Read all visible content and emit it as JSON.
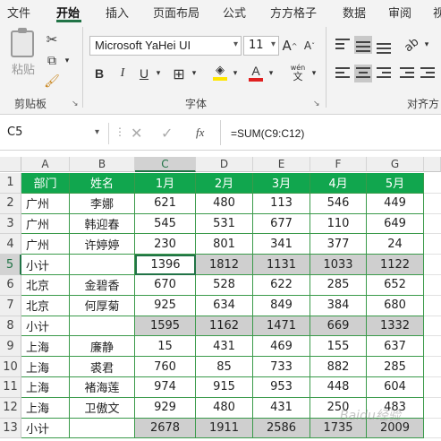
{
  "ribbon": {
    "tabs": [
      "文件",
      "开始",
      "插入",
      "页面布局",
      "公式",
      "方方格子",
      "数据",
      "审阅",
      "视"
    ],
    "active_tab": "开始",
    "clipboard": {
      "paste_label": "粘贴",
      "group_label": "剪贴板"
    },
    "font": {
      "name": "Microsoft YaHei UI",
      "size": "11",
      "grow": "A",
      "shrink": "A",
      "bold": "B",
      "italic": "I",
      "underline": "U",
      "wen_top": "wén",
      "wen_bottom": "文",
      "group_label": "字体"
    },
    "alignment": {
      "group_label": "对齐方"
    },
    "colors": {
      "accent": "#217346",
      "highlight": "#ffe600",
      "font_color": "#e02020"
    }
  },
  "formula_bar": {
    "name_box": "C5",
    "fx": "fx",
    "formula": "=SUM(C9:C12)"
  },
  "sheet": {
    "columns": [
      "A",
      "B",
      "C",
      "D",
      "E",
      "F",
      "G"
    ],
    "rows": [
      "1",
      "2",
      "3",
      "4",
      "5",
      "6",
      "7",
      "8",
      "9",
      "10",
      "11",
      "12",
      "13"
    ],
    "selected_cell": "C5",
    "header": [
      "部门",
      "姓名",
      "1月",
      "2月",
      "3月",
      "4月",
      "5月"
    ],
    "data": [
      [
        "广州",
        "李娜",
        "621",
        "480",
        "113",
        "546",
        "449"
      ],
      [
        "广州",
        "韩迎春",
        "545",
        "531",
        "677",
        "110",
        "649"
      ],
      [
        "广州",
        "许婷婷",
        "230",
        "801",
        "341",
        "377",
        "24"
      ],
      [
        "小计",
        "",
        "1396",
        "1812",
        "1131",
        "1033",
        "1122"
      ],
      [
        "北京",
        "金碧香",
        "670",
        "528",
        "622",
        "285",
        "652"
      ],
      [
        "北京",
        "何厚菊",
        "925",
        "634",
        "849",
        "384",
        "680"
      ],
      [
        "小计",
        "",
        "1595",
        "1162",
        "1471",
        "669",
        "1332"
      ],
      [
        "上海",
        "廉静",
        "15",
        "431",
        "469",
        "155",
        "637"
      ],
      [
        "上海",
        "裘君",
        "760",
        "85",
        "733",
        "882",
        "285"
      ],
      [
        "上海",
        "褚海莲",
        "974",
        "915",
        "953",
        "448",
        "604"
      ],
      [
        "上海",
        "卫傲文",
        "929",
        "480",
        "431",
        "250",
        "483"
      ],
      [
        "小计",
        "",
        "2678",
        "1911",
        "2586",
        "1735",
        "2009"
      ]
    ],
    "header_color": "#11a64e",
    "subtotal_color": "#cfcfcf"
  },
  "watermark": "Baidu经验"
}
